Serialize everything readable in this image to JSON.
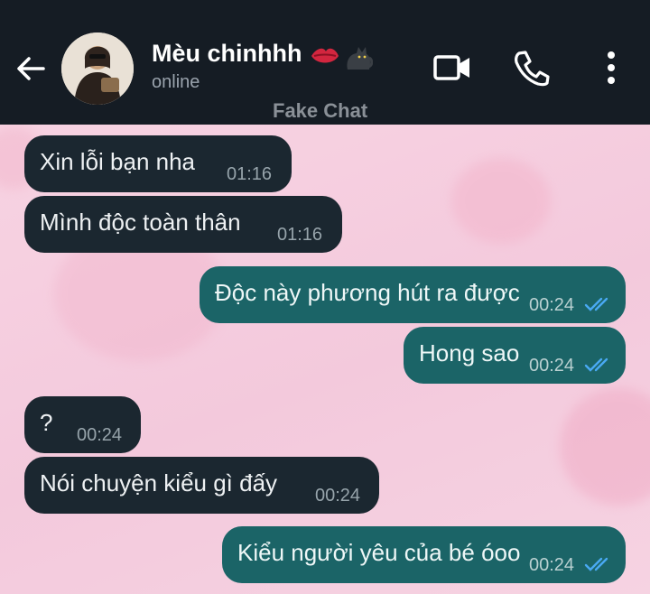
{
  "header": {
    "back_icon": "back-arrow-icon",
    "contact_name": "Mèu chinhhh",
    "emoji_icons": [
      "kiss-mark-icon",
      "black-cat-icon"
    ],
    "status": "online",
    "actions": [
      "video-call-icon",
      "phone-call-icon",
      "more-options-icon"
    ]
  },
  "watermark": "Fake Chat",
  "colors": {
    "header_bg": "#151c24",
    "incoming_bubble": "#1b2730",
    "outgoing_bubble": "#1b6467",
    "read_tick": "#49a9f2"
  },
  "messages": [
    {
      "direction": "incoming",
      "text": "Xin lỗi bạn nha",
      "time": "01:16"
    },
    {
      "direction": "incoming",
      "text": "Mình độc toàn thân",
      "time": "01:16"
    },
    {
      "direction": "outgoing",
      "text": "Độc này phương hút ra được",
      "time": "00:24",
      "read": true
    },
    {
      "direction": "outgoing",
      "text": "Hong sao",
      "time": "00:24",
      "read": true
    },
    {
      "direction": "incoming",
      "text": "?",
      "time": "00:24"
    },
    {
      "direction": "incoming",
      "text": "Nói chuyện kiểu gì đấy",
      "time": "00:24"
    },
    {
      "direction": "outgoing",
      "text": "Kiểu người yêu của bé óoo",
      "time": "00:24",
      "read": true
    }
  ]
}
